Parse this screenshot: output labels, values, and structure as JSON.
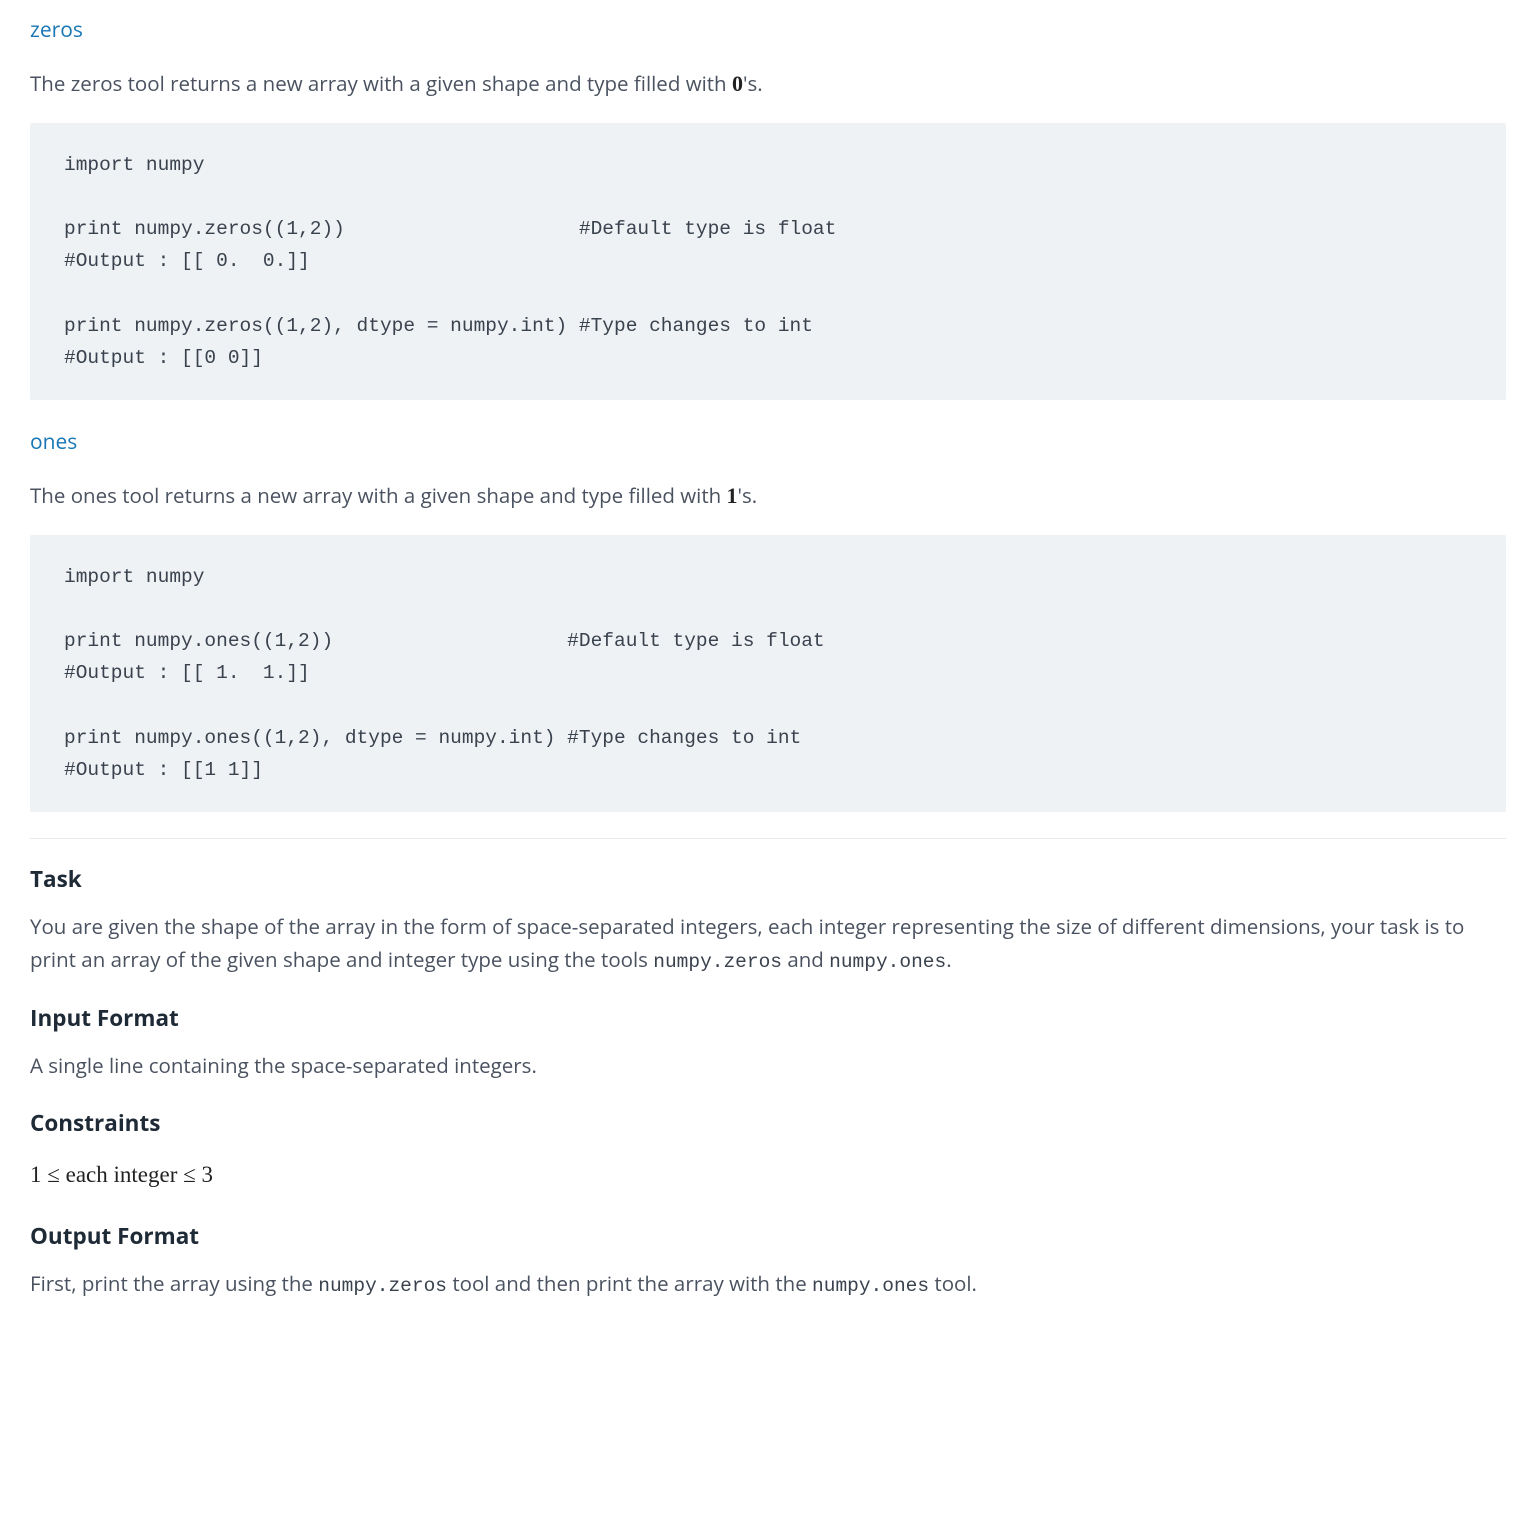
{
  "zeros": {
    "link_text": "zeros",
    "desc_pre": "The zeros tool returns a new array with a given shape and type filled with ",
    "desc_bold": "0",
    "desc_post": "'s.",
    "code": "import numpy\n\nprint numpy.zeros((1,2))                    #Default type is float\n#Output : [[ 0.  0.]] \n\nprint numpy.zeros((1,2), dtype = numpy.int) #Type changes to int\n#Output : [[0 0]]"
  },
  "ones": {
    "link_text": "ones",
    "desc_pre": "The ones tool returns a new array with a given shape and type filled with ",
    "desc_bold": "1",
    "desc_post": "'s.",
    "code": "import numpy\n\nprint numpy.ones((1,2))                    #Default type is float\n#Output : [[ 1.  1.]] \n\nprint numpy.ones((1,2), dtype = numpy.int) #Type changes to int\n#Output : [[1 1]] "
  },
  "task": {
    "heading": "Task",
    "text_pre": "You are given the shape of the array in the form of space-separated integers, each integer representing the size of different dimensions, your task is to print an array of the given shape and integer type using the tools ",
    "code1": "numpy.zeros",
    "mid": " and ",
    "code2": "numpy.ones",
    "text_post": "."
  },
  "input_format": {
    "heading": "Input Format",
    "text": "A single line containing the space-separated integers."
  },
  "constraints": {
    "heading": "Constraints",
    "text": "1 ≤ each integer ≤ 3"
  },
  "output_format": {
    "heading": "Output Format",
    "text_pre": "First, print the array using the ",
    "code1": "numpy.zeros",
    "mid": " tool and then print the array with the ",
    "code2": "numpy.ones",
    "text_post": " tool."
  }
}
